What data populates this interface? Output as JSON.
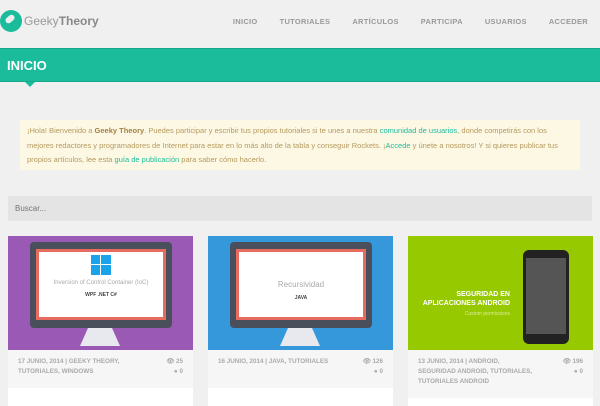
{
  "header": {
    "logo_light": "Geeky",
    "logo_bold": "Theory",
    "nav": [
      "INICIO",
      "TUTORIALES",
      "ARTÍCULOS",
      "PARTICIPA",
      "USUARIOS",
      "ACCEDER"
    ]
  },
  "page_title": "INICIO",
  "notice": {
    "t1": "¡Hola! Bienvenido a ",
    "b1": "Geeky Theory",
    "t2": ". Puedes participar y escribir tus propios tutoriales si te unes a nuestra ",
    "l1": "comunidad de usuarios",
    "t3": ", donde competirás con los mejores redactores y programadores de Internet para estar en lo más alto de la tabla y conseguir Rockets. ¡",
    "l2": "Accede",
    "t4": " y únete a nosotros! Y si quieres publicar tus propios artículos, lee esta ",
    "l3": "guía de publicación",
    "t5": " para saber cómo hacerlo."
  },
  "search": {
    "placeholder": "Buscar..."
  },
  "cards": [
    {
      "img_title": "Inversion of Control Container (IoC)",
      "img_sub": "WPF .NET C#",
      "meta": "17 JUNIO, 2014  | GEEKY THEORY, TUTORIALES, WINDOWS",
      "views": "25",
      "comments": "0",
      "color": "#9b59b6"
    },
    {
      "img_title": "Recursividad",
      "img_sub": "JAVA",
      "meta": "16 JUNIO, 2014  | JAVA, TUTORIALES",
      "views": "126",
      "comments": "0",
      "color": "#3498db"
    },
    {
      "img_title": "SEGURIDAD EN APLICACIONES ANDROID",
      "img_sub": "Custom permissions",
      "meta": "13 JUNIO, 2014  | ANDROID, SEGURIDAD ANDROID, TUTORIALES, TUTORIALES ANDROID",
      "views": "196",
      "comments": "0",
      "color": "#97c900"
    }
  ]
}
